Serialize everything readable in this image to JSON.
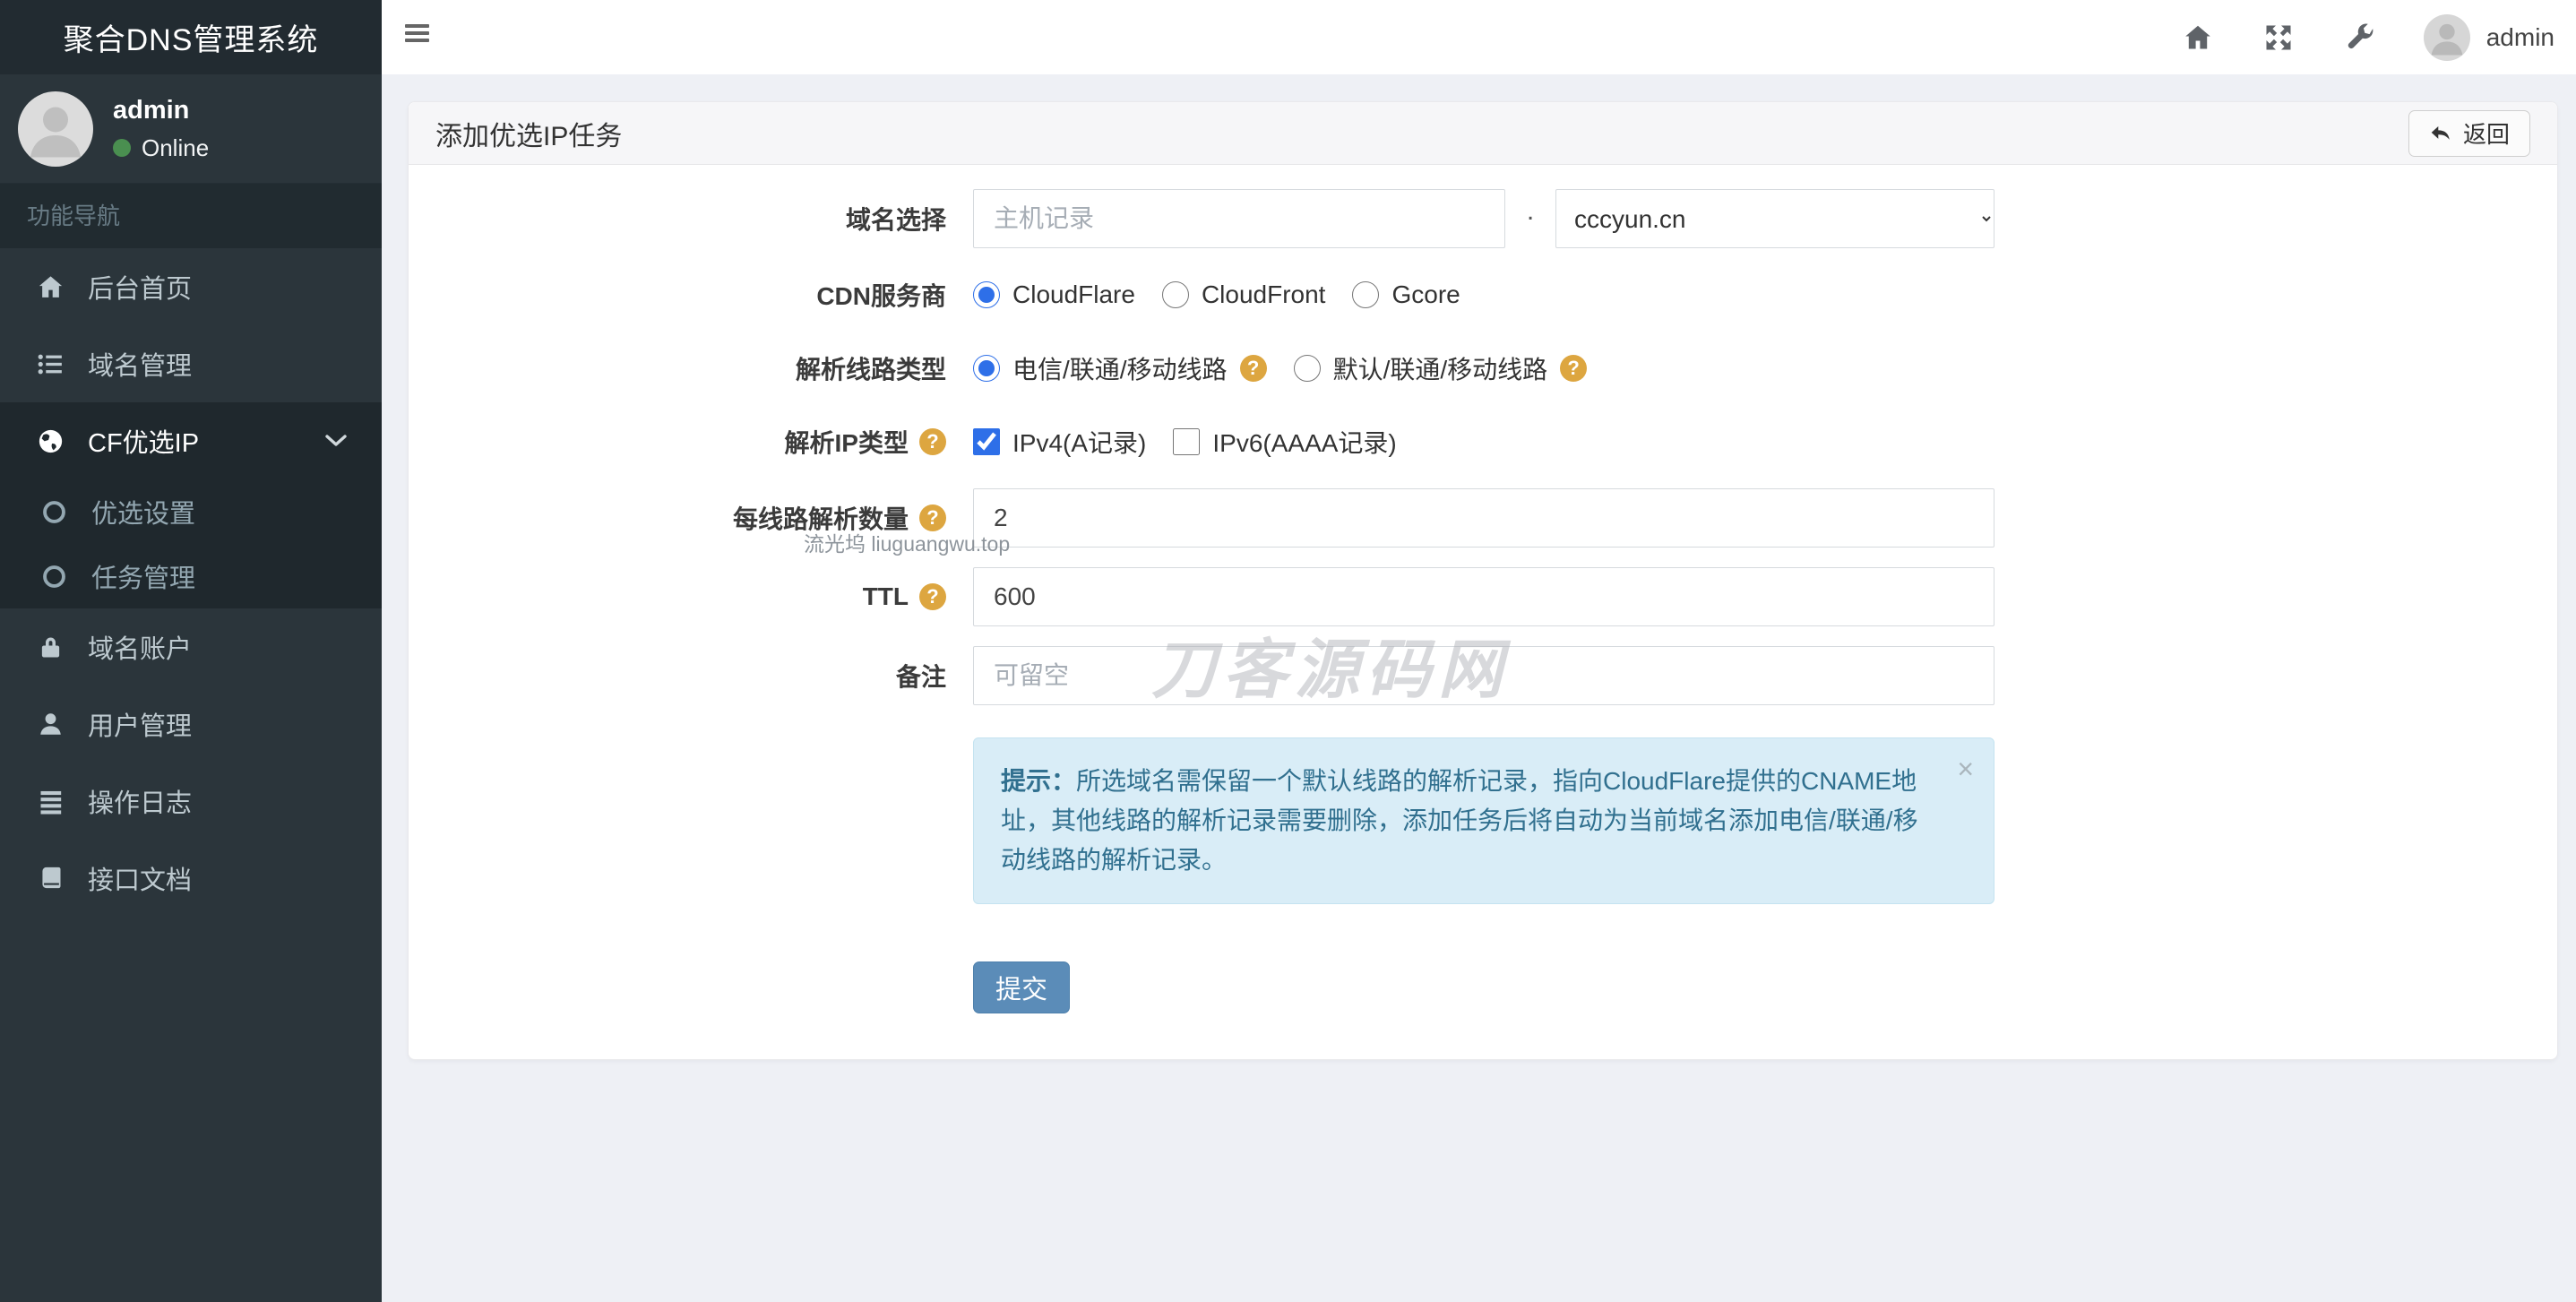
{
  "app": {
    "title": "聚合DNS管理系统"
  },
  "sidebar": {
    "user": {
      "name": "admin",
      "status": "Online"
    },
    "nav_header": "功能导航",
    "items": [
      {
        "label": "后台首页",
        "icon": "home-icon"
      },
      {
        "label": "域名管理",
        "icon": "list-icon"
      },
      {
        "label": "CF优选IP",
        "icon": "globe-icon",
        "expanded": true,
        "children": [
          {
            "label": "优选设置",
            "icon": "circle-icon"
          },
          {
            "label": "任务管理",
            "icon": "circle-icon"
          }
        ]
      },
      {
        "label": "域名账户",
        "icon": "lock-icon"
      },
      {
        "label": "用户管理",
        "icon": "user-icon"
      },
      {
        "label": "操作日志",
        "icon": "log-list-icon"
      },
      {
        "label": "接口文档",
        "icon": "book-icon"
      }
    ]
  },
  "topbar": {
    "username": "admin"
  },
  "panel": {
    "title": "添加优选IP任务",
    "back_label": "返回"
  },
  "form": {
    "domain": {
      "label": "域名选择",
      "host_placeholder": "主机记录",
      "separator": ".",
      "selected_domain": "cccyun.cn"
    },
    "cdn": {
      "label": "CDN服务商",
      "options": [
        {
          "label": "CloudFlare",
          "selected": true
        },
        {
          "label": "CloudFront"
        },
        {
          "label": "Gcore"
        }
      ]
    },
    "line_type": {
      "label": "解析线路类型",
      "options": [
        {
          "label": "电信/联通/移动线路",
          "selected": true
        },
        {
          "label": "默认/联通/移动线路"
        }
      ]
    },
    "ip_type": {
      "label": "解析IP类型",
      "options": [
        {
          "label": "IPv4(A记录)",
          "checked": true
        },
        {
          "label": "IPv6(AAAA记录)"
        }
      ]
    },
    "per_line": {
      "label": "每线路解析数量",
      "value": "2"
    },
    "ttl": {
      "label": "TTL",
      "value": "600"
    },
    "remark": {
      "label": "备注",
      "placeholder": "可留空"
    },
    "alert": {
      "prefix": "提示：",
      "text": "所选域名需保留一个默认线路的解析记录，指向CloudFlare提供的CNAME地址，其他线路的解析记录需要删除，添加任务后将自动为当前域名添加电信/联通/移动线路的解析记录。"
    },
    "submit_label": "提交"
  },
  "watermarks": {
    "small": "流光坞 liuguangwu.top",
    "large": "刀客源码网"
  },
  "icons": {
    "question_glyph": "?",
    "close_glyph": "×"
  },
  "colors": {
    "sidebar_bg": "#2b353b",
    "sidebar_block_bg": "#1f282d",
    "submit_blue": "#5b8cb8",
    "help_orange": "#dda640",
    "alert_bg": "#d9edf7",
    "alert_text": "#31708f",
    "online_green": "#4a8f50"
  }
}
